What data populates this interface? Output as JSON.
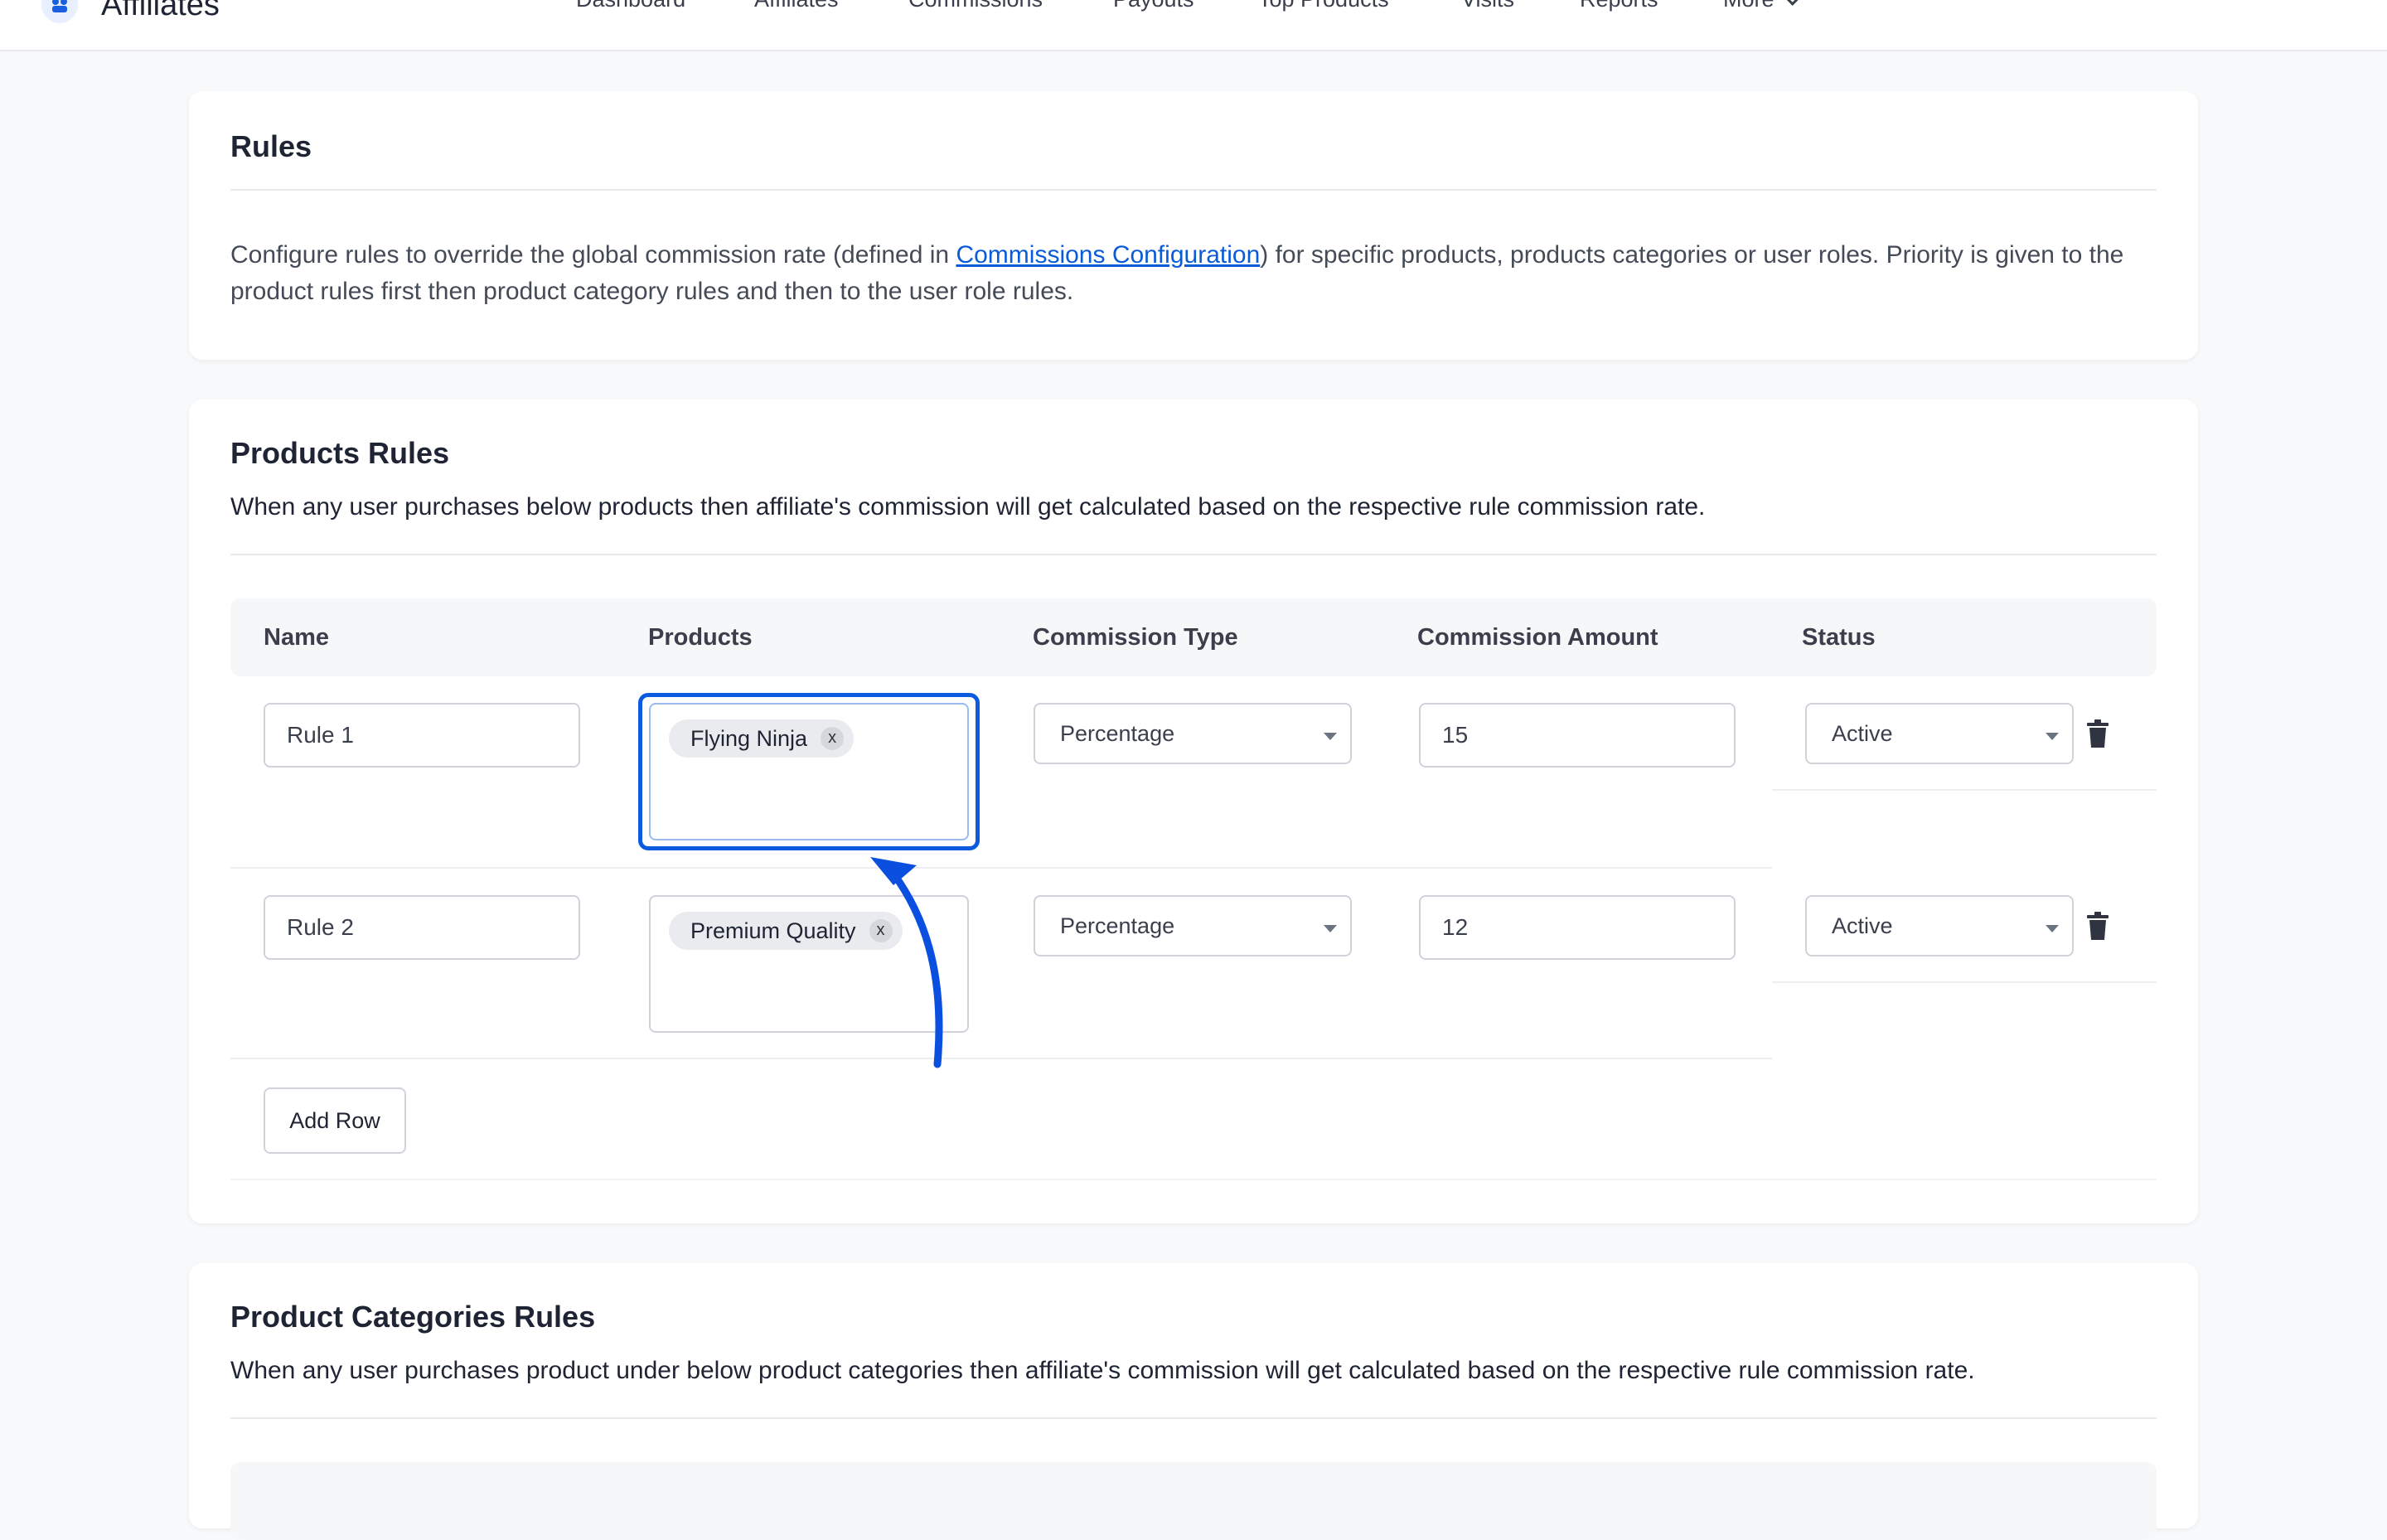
{
  "brand": {
    "name": "Affiliates"
  },
  "nav": {
    "items": [
      "Dashboard",
      "Affiliates",
      "Commissions",
      "Payouts",
      "Top Products",
      "Visits",
      "Reports"
    ],
    "more": "More"
  },
  "rules_card": {
    "title": "Rules",
    "desc_before": "Configure rules to override the global commission rate (defined in ",
    "desc_link": "Commissions Configuration",
    "desc_after": ") for specific products, products categories or user roles. Priority is given to the product rules first then product category rules and then to the user role rules."
  },
  "products_rules": {
    "title": "Products Rules",
    "description": "When any user purchases below products then affiliate's commission will get calculated based on the respective rule commission rate.",
    "columns": [
      "Name",
      "Products",
      "Commission Type",
      "Commission Amount",
      "Status"
    ],
    "rows": [
      {
        "name": "Rule 1",
        "product": "Flying Ninja",
        "product_remove": "x",
        "commission_type": "Percentage",
        "amount": "15",
        "status": "Active"
      },
      {
        "name": "Rule 2",
        "product": "Premium Quality",
        "product_remove": "x",
        "commission_type": "Percentage",
        "amount": "12",
        "status": "Active"
      }
    ],
    "add_row_label": "Add Row"
  },
  "categories_rules": {
    "title": "Product Categories Rules",
    "description": "When any user purchases product under below product categories then affiliate's commission will get calculated based on the respective rule commission rate."
  },
  "colors": {
    "accent": "#0b5ae0",
    "link": "#0a5bd8",
    "text": "#1e2433"
  },
  "icons": {
    "logo": "affiliates-logo-icon",
    "delete": "trash-icon",
    "dropdown": "caret-down-icon"
  }
}
